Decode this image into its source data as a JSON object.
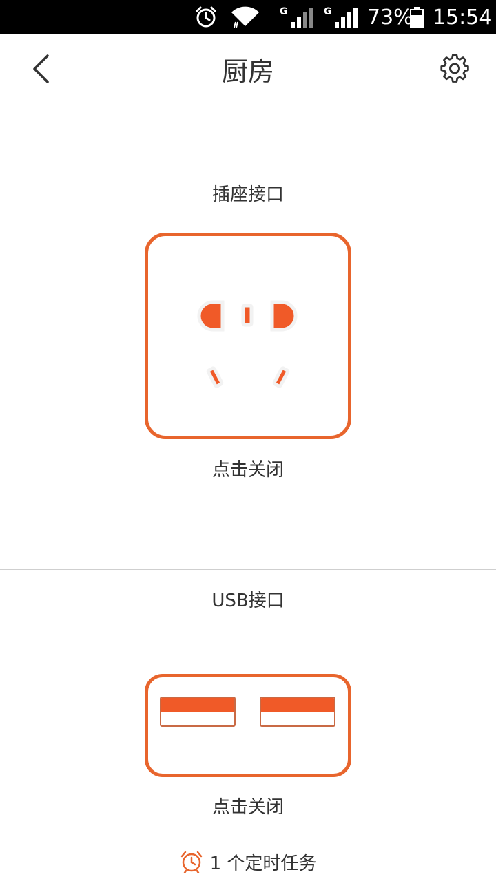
{
  "status_bar": {
    "network_label_1": "G",
    "network_label_2": "G",
    "battery_percent": "73%",
    "time": "15:54"
  },
  "header": {
    "title": "厨房"
  },
  "socket": {
    "section_label": "插座接口",
    "action_label": "点击关闭"
  },
  "usb": {
    "section_label": "USB接口",
    "action_label": "点击关闭"
  },
  "timer": {
    "text": "1 个定时任务"
  },
  "colors": {
    "accent": "#e8652d",
    "background": "#ffffff",
    "text": "#333333",
    "divider": "#cfcfcf"
  },
  "icons": [
    "alarm-icon",
    "wifi-icon",
    "signal-icon",
    "battery-icon",
    "back-arrow-icon",
    "gear-icon",
    "socket-icon",
    "usb-port-icon",
    "alarm-clock-icon"
  ]
}
